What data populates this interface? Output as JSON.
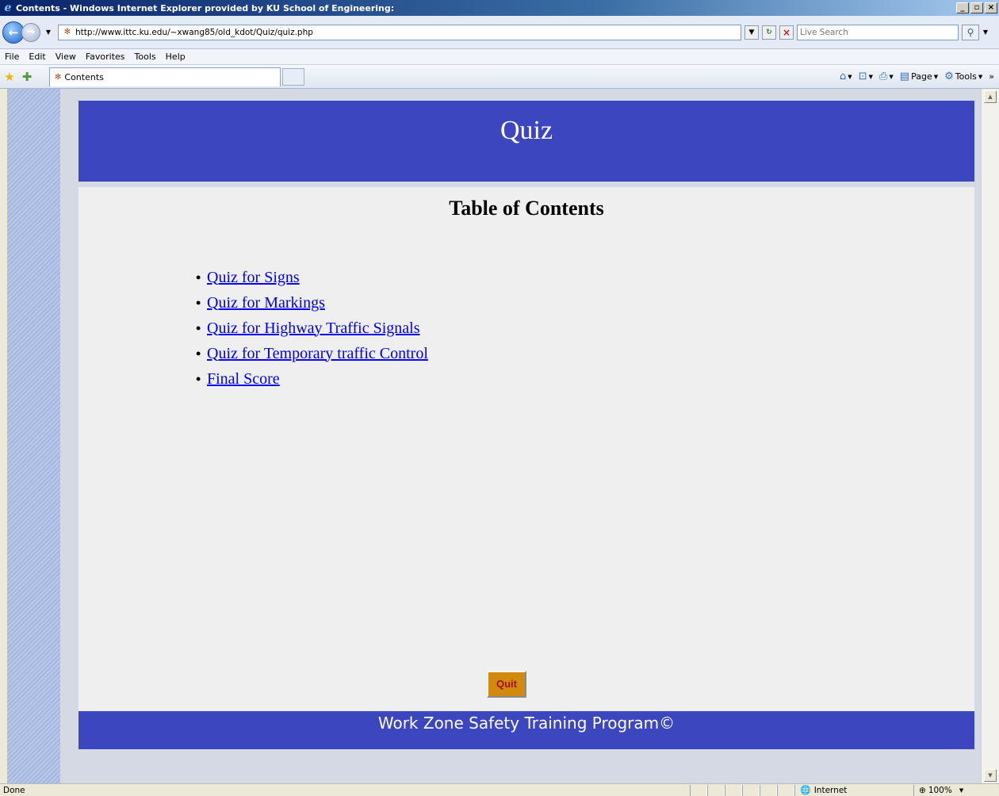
{
  "window": {
    "title": "Contents - Windows Internet Explorer provided by KU School of Engineering:",
    "controls": [
      "_",
      "▫",
      "×"
    ]
  },
  "address": {
    "url": "http://www.ittc.ku.edu/~xwang85/old_kdot/Quiz/quiz.php",
    "search_placeholder": "Live Search"
  },
  "menu": {
    "items": [
      "File",
      "Edit",
      "View",
      "Favorites",
      "Tools",
      "Help"
    ]
  },
  "tabs": {
    "active_label": "Contents"
  },
  "commands": {
    "page_label": "Page",
    "tools_label": "Tools"
  },
  "page": {
    "header_title": "Quiz",
    "toc_heading": "Table of Contents",
    "links": [
      "Quiz for Signs",
      "Quiz for Markings",
      "Quiz for Highway Traffic Signals",
      "Quiz for Temporary traffic Control",
      "Final Score"
    ],
    "quit_label": "Quit",
    "footer_text": "Work Zone Safety Training Program©"
  },
  "status": {
    "text": "Done",
    "zone": "Internet",
    "zoom": "100%"
  },
  "colors": {
    "header_blue": "#3c46bf",
    "link_blue": "#0000ee",
    "quit_orange": "#d28a0e",
    "quit_text": "#a01010"
  }
}
